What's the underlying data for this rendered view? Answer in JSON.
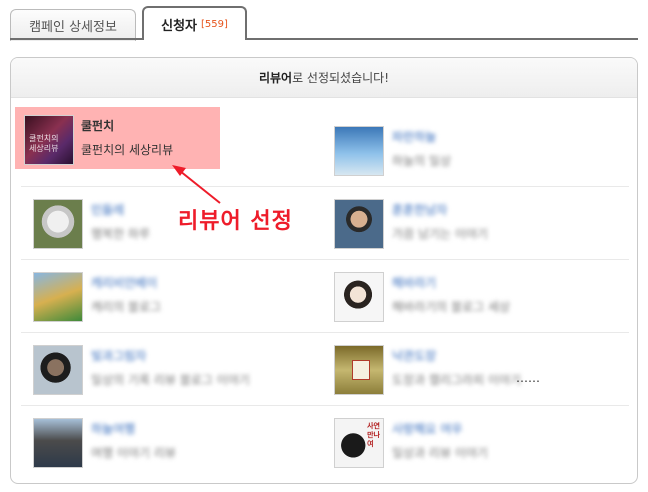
{
  "tabs": [
    {
      "label": "캠페인 상세정보"
    },
    {
      "label": "신청자",
      "count": "[559]"
    }
  ],
  "panel": {
    "title_bold": "리뷰어",
    "title_rest": "로 선정되셨습니다!"
  },
  "applicants": [
    {
      "name": "쿨펀치",
      "blog": "쿨펀치의 세상리뷰",
      "selected": true
    },
    {
      "name": "파란하늘",
      "blog": "하늘의 일상"
    },
    {
      "name": "민들레",
      "blog": "행복한 하루"
    },
    {
      "name": "훈훈한남자",
      "blog": "가끔 남기는 이야기"
    },
    {
      "name": "캐리비안베이",
      "blog": "캐리의 블로그"
    },
    {
      "name": "해바라기",
      "blog": "해바라기의 블로그 세상"
    },
    {
      "name": "빛과그림자",
      "blog": "일상의 기록 리뷰 블로그 이야기"
    },
    {
      "name": "낙관도장",
      "blog": "도장과 캘리그라피 이야기",
      "suffix": "……"
    },
    {
      "name": "하늘여행",
      "blog": "여행 이야기 리뷰"
    },
    {
      "name": "사랑해요 여우",
      "blog": "일상과 리뷰 이야기"
    }
  ],
  "annotation": {
    "text": "리뷰어 선정",
    "color": "#ee1c2a"
  },
  "colors": {
    "highlight": "#ffb3b3",
    "count": "#e6541c"
  }
}
